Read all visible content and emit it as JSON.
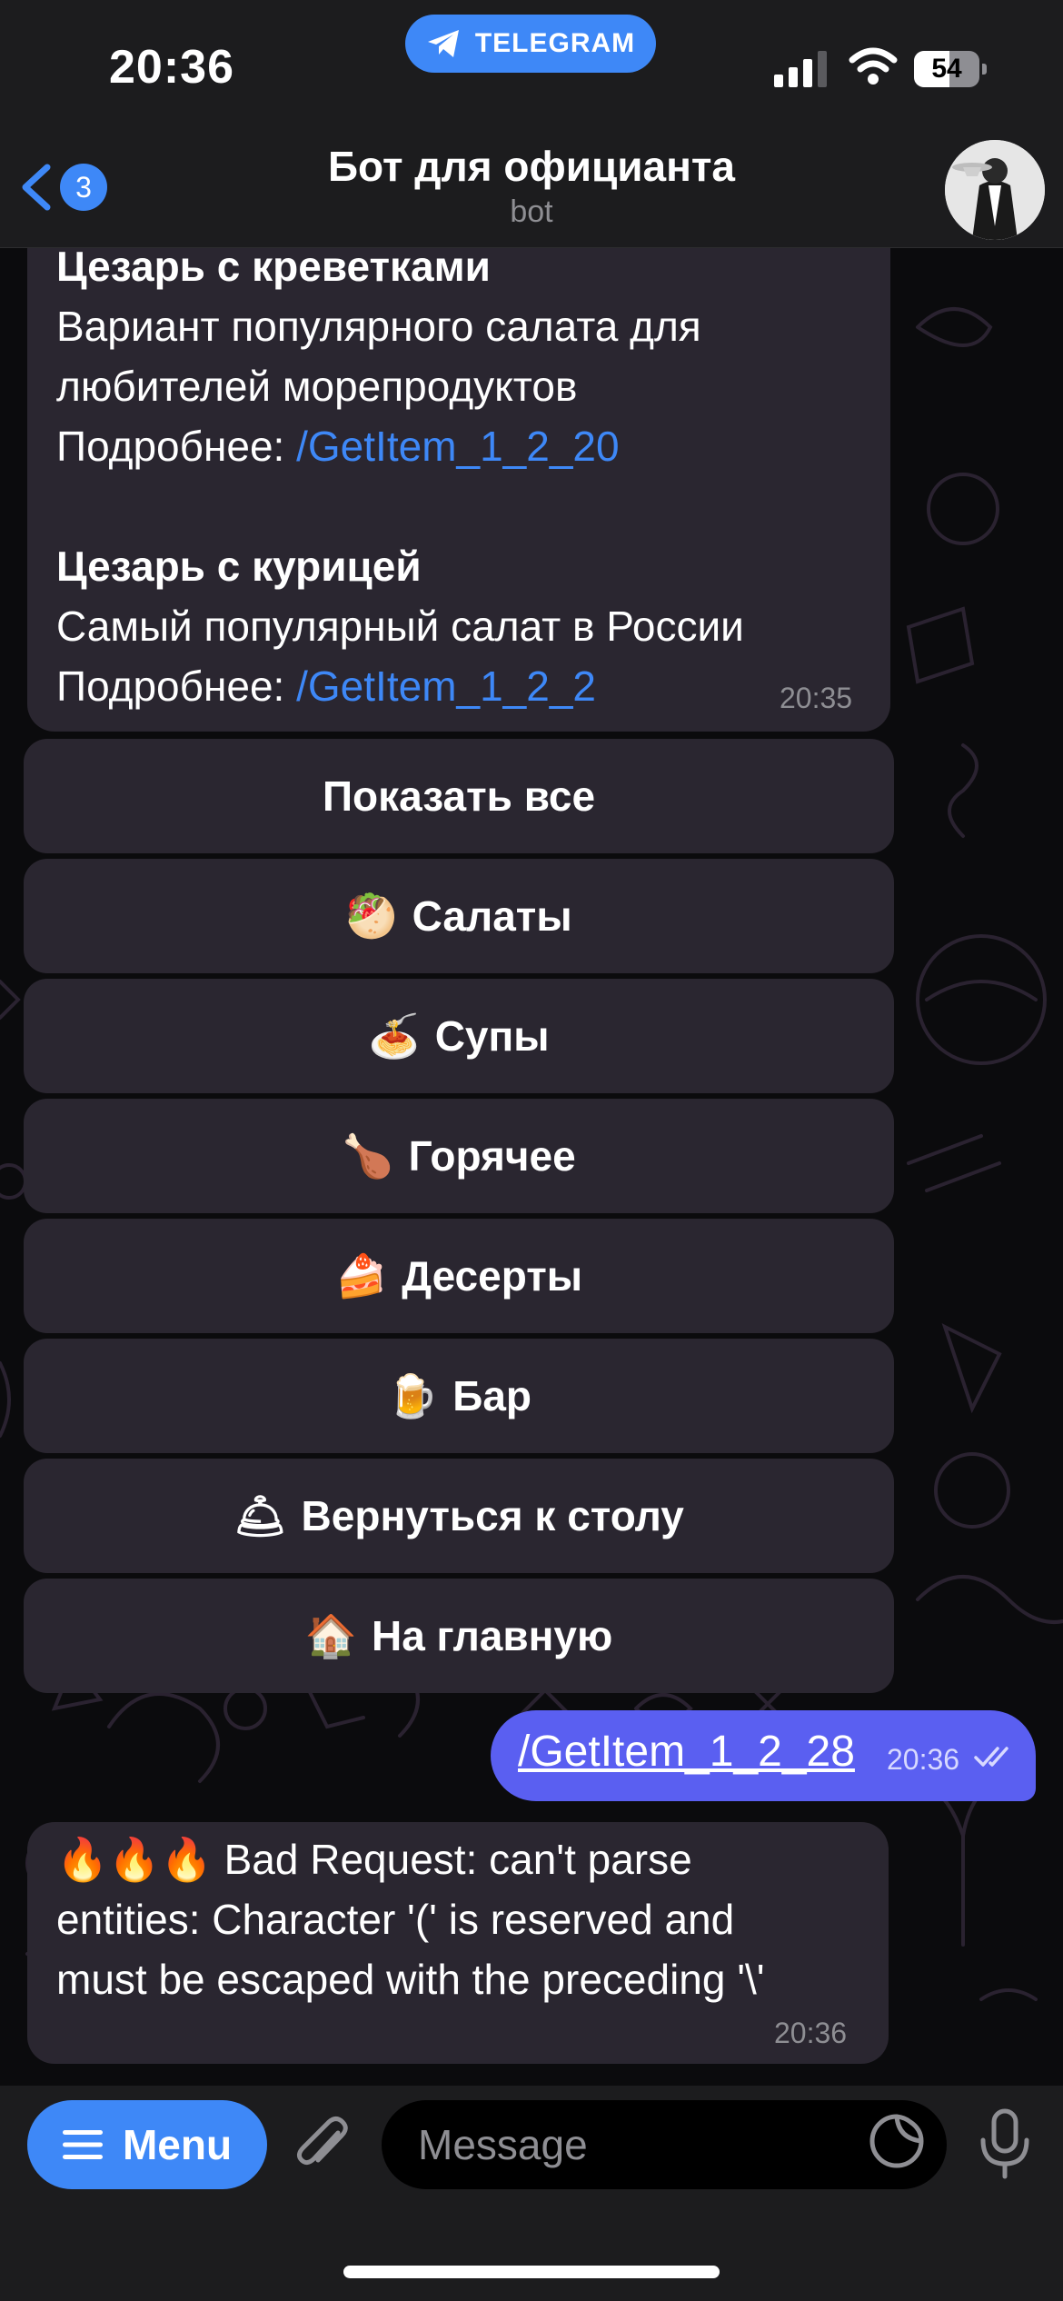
{
  "status_bar": {
    "time": "20:36",
    "app_pill": "TELEGRAM",
    "battery_level": "54",
    "icons": [
      "telegram-icon",
      "signal-icon",
      "wifi-icon",
      "battery-icon"
    ]
  },
  "header": {
    "back_count": "3",
    "title": "Бот для официанта",
    "subtitle": "bot",
    "icons": [
      "back-chevron-icon",
      "avatar"
    ]
  },
  "messages": {
    "bot_menu": {
      "item1_title": "Цезарь с креветками",
      "item1_desc_l1": "Вариант популярного салата для",
      "item1_desc_l2": "любителей морепродуктов",
      "item1_more": "Подробнее: ",
      "item1_link": "/GetItem_1_2_20",
      "item2_title": "Цезарь с курицей",
      "item2_desc": "Самый популярный салат в России",
      "item2_more": "Подробнее: ",
      "item2_link": "/GetItem_1_2_2",
      "time": "20:35"
    },
    "keyboard": [
      {
        "emoji": "",
        "label": "Показать все"
      },
      {
        "emoji": "🥙",
        "label": "Салаты"
      },
      {
        "emoji": "🍝",
        "label": "Супы"
      },
      {
        "emoji": "🍗",
        "label": "Горячее"
      },
      {
        "emoji": "🍰",
        "label": "Десерты"
      },
      {
        "emoji": "🍺",
        "label": "Бар"
      },
      {
        "emoji": "🛎",
        "label": "Вернуться к столу"
      },
      {
        "emoji": "🏠",
        "label": "На главную"
      }
    ],
    "outgoing": {
      "text": "/GetItem_1_2_28",
      "time": "20:36"
    },
    "bot_error": {
      "line1": "🔥🔥🔥 Bad Request: can't parse",
      "line2": "entities: Character '(' is reserved and",
      "line3": "must be escaped with the preceding '\\'",
      "time": "20:36"
    }
  },
  "composer": {
    "menu_label": "Menu",
    "placeholder": "Message",
    "icons": [
      "menu-lines-icon",
      "paperclip-icon",
      "sticker-icon",
      "microphone-icon"
    ]
  },
  "colors": {
    "accent": "#3e88f7",
    "outgoing_bubble": "#5a5ff1",
    "incoming_bubble": "#2a2630",
    "bar_background": "#1c1c1e"
  }
}
